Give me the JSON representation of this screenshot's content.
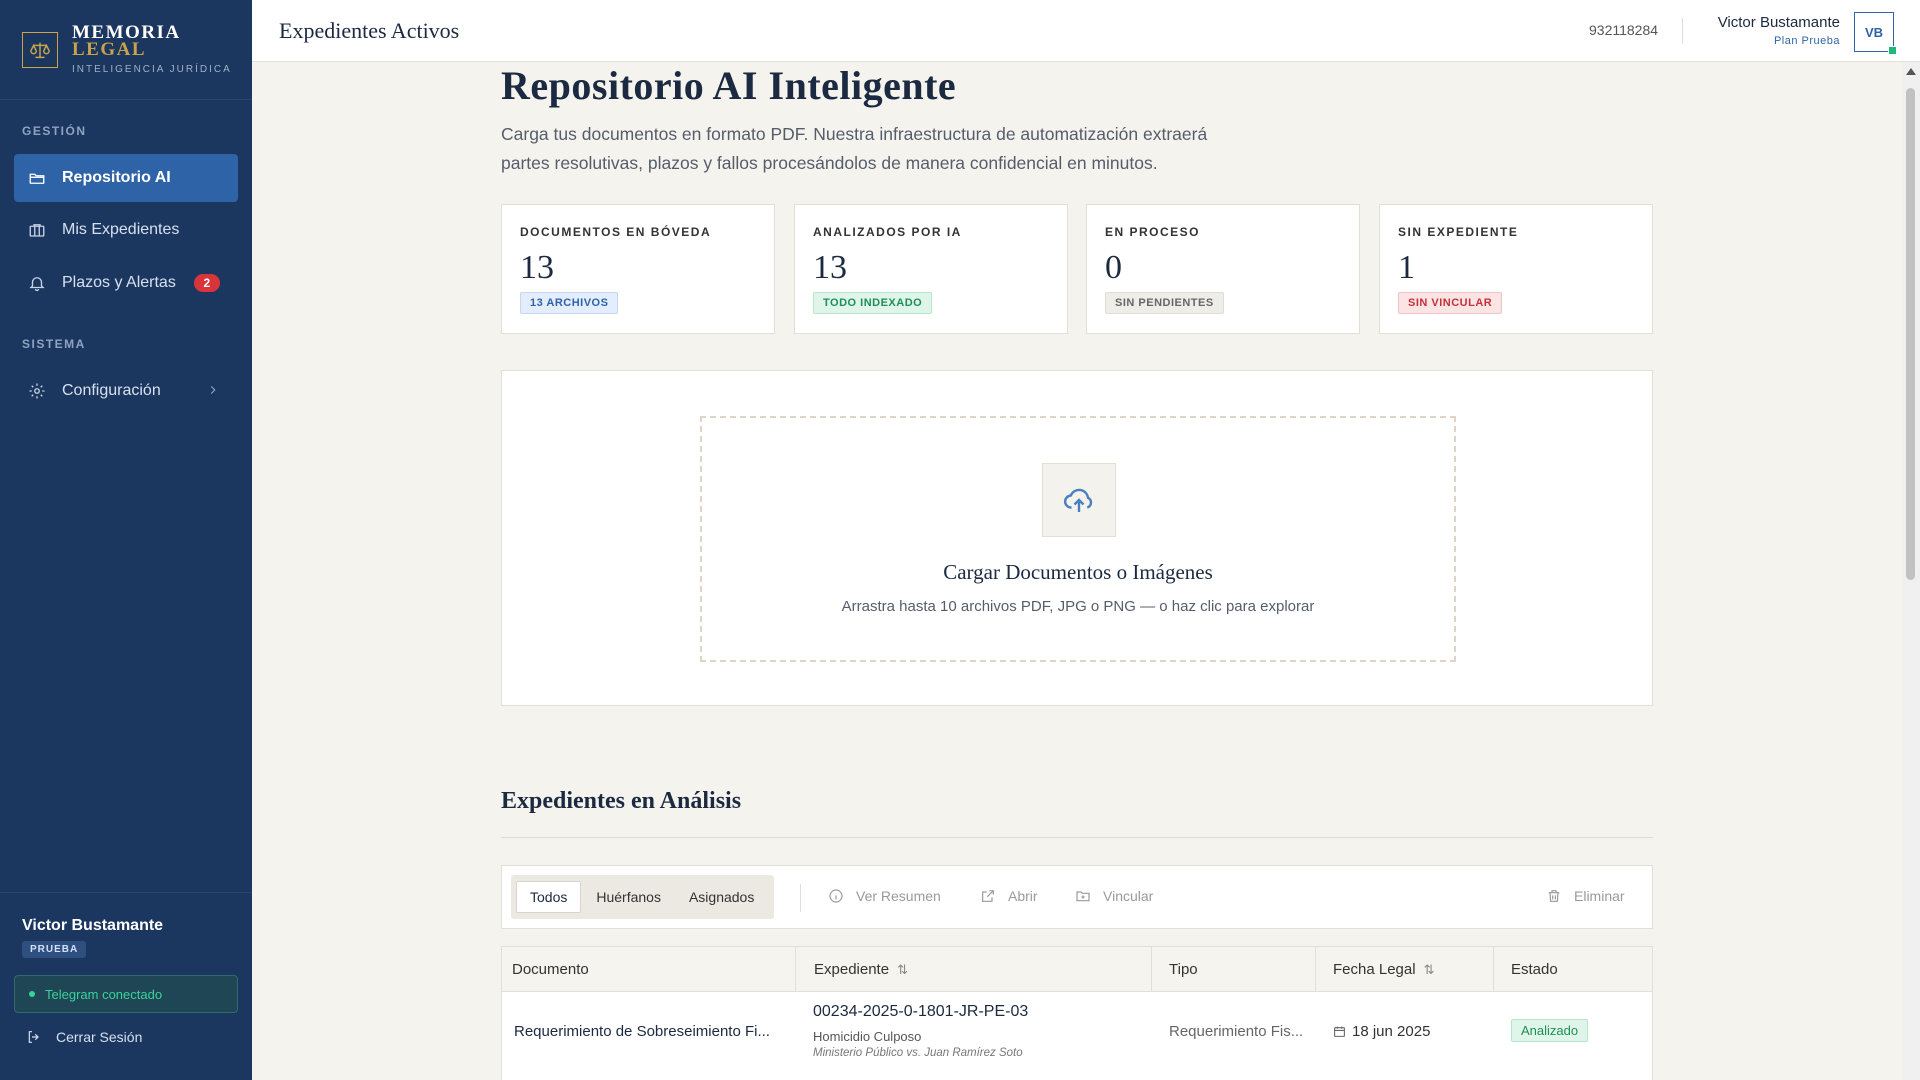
{
  "brand": {
    "line1": "MEMORIA",
    "line2": "LEGAL",
    "tagline": "INTELIGENCIA JURÍDICA"
  },
  "sidebar": {
    "sections": [
      {
        "label": "GESTIÓN"
      },
      {
        "label": "SISTEMA"
      }
    ],
    "items": [
      {
        "label": "Repositorio AI",
        "icon": "folder-open-icon",
        "active": true
      },
      {
        "label": "Mis Expedientes",
        "icon": "briefcase-icon"
      },
      {
        "label": "Plazos y Alertas",
        "icon": "bell-icon",
        "badge": "2"
      },
      {
        "label": "Configuración",
        "icon": "gear-icon"
      }
    ],
    "footer": {
      "user_name": "Victor Bustamante",
      "plan": "PRUEBA",
      "telegram": "Telegram conectado",
      "logout": "Cerrar Sesión"
    }
  },
  "header": {
    "title": "Expedientes Activos",
    "phone": "932118284",
    "user_name": "Victor Bustamante",
    "user_plan": "Plan Prueba",
    "avatar": "VB"
  },
  "main": {
    "title": "Repositorio AI Inteligente",
    "subtitle_line1": "Carga tus documentos en formato PDF. Nuestra infraestructura de automatización extraerá",
    "subtitle_line2": "partes resolutivas, plazos y fallos procesándolos de manera confidencial en minutos."
  },
  "stats": [
    {
      "label": "DOCUMENTOS EN BÓVEDA",
      "value": "13",
      "tag": "13 ARCHIVOS",
      "tag_color": "#2f63a8"
    },
    {
      "label": "ANALIZADOS POR IA",
      "value": "13",
      "tag": "TODO INDEXADO",
      "tag_color": "#1f8e58"
    },
    {
      "label": "EN PROCESO",
      "value": "0",
      "tag": "SIN PENDIENTES",
      "tag_color": "#666666"
    },
    {
      "label": "SIN EXPEDIENTE",
      "value": "1",
      "tag": "SIN VINCULAR",
      "tag_color": "#c4323a"
    }
  ],
  "upload": {
    "icon": "cloud-upload-icon",
    "title": "Cargar Documentos o Imágenes",
    "description": "Arrastra hasta 10 archivos PDF, JPG o PNG — o haz clic para explorar"
  },
  "section": {
    "title": "Expedientes en Análisis"
  },
  "toolbar": {
    "filters": [
      {
        "label": "Todos",
        "active": true
      },
      {
        "label": "Huérfanos"
      },
      {
        "label": "Asignados"
      }
    ],
    "actions": {
      "summary": "Ver Resumen",
      "open": "Abrir",
      "link": "Vincular",
      "delete": "Eliminar"
    }
  },
  "table": {
    "columns": [
      "Documento",
      "Expediente",
      "Tipo",
      "Fecha Legal",
      "Estado"
    ],
    "rows": [
      {
        "documento": "Requerimiento de Sobreseimiento Fi...",
        "expediente": "00234-2025-0-1801-JR-PE-03",
        "delito": "Homicidio Culposo",
        "partes": "Ministerio Público vs. Juan Ramírez Soto",
        "tipo": "Requerimiento Fis...",
        "fecha": "18 jun 2025",
        "estado": "Analizado"
      }
    ]
  },
  "colors": {
    "sidebar": "#1b365f",
    "accent": "#2f63a8",
    "gold": "#c9a24a",
    "background": "#f5f3ee"
  }
}
